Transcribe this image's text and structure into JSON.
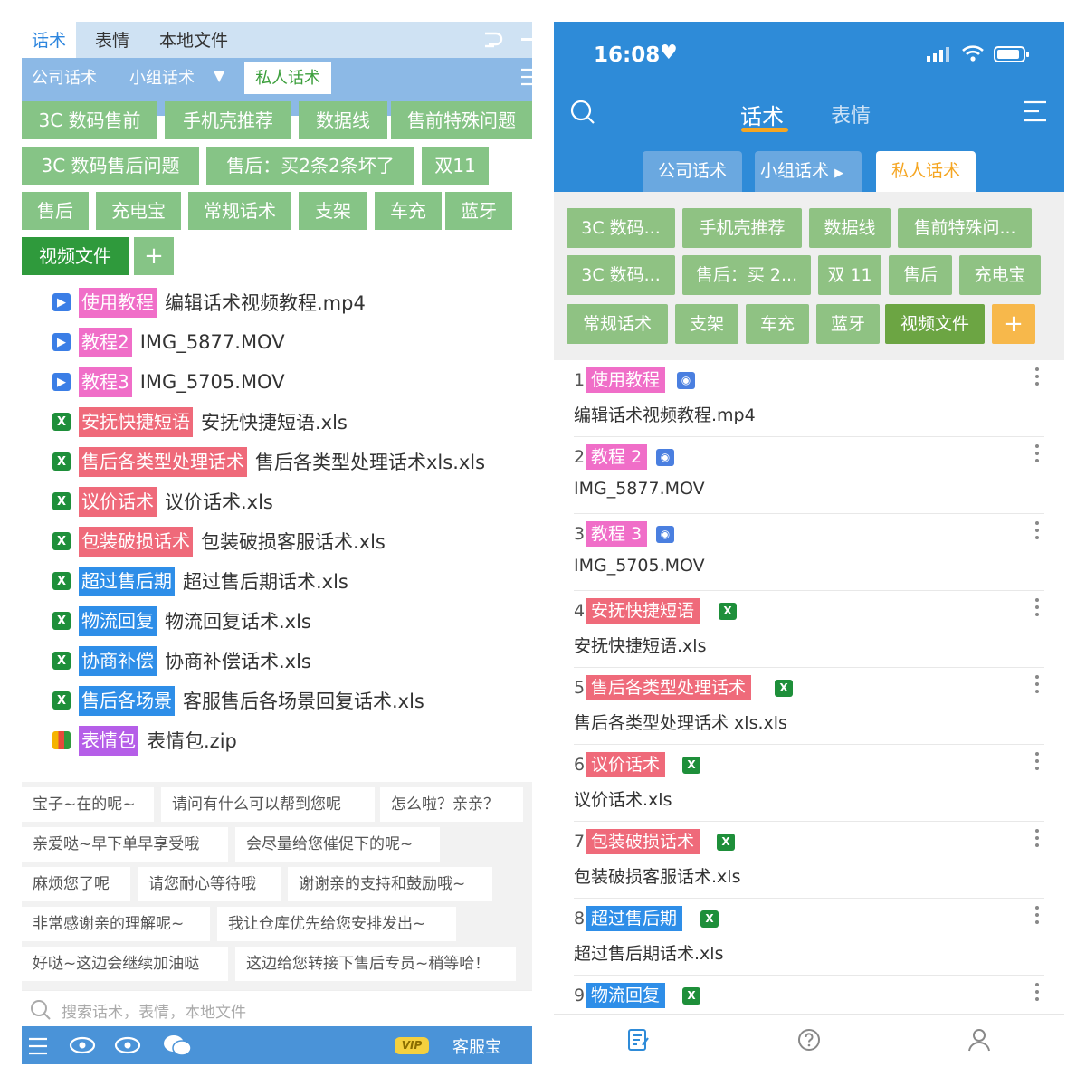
{
  "colors": {
    "pink": "#f06ec8",
    "red": "#ef6a7a",
    "blue": "#2e8ee8",
    "purple": "#b55ee8",
    "green": "#86c486",
    "dark_green": "#2f9a3c",
    "app_blue": "#2e8bd8",
    "orange": "#f5a623"
  },
  "left": {
    "top_tabs": [
      "话术",
      "表情",
      "本地文件"
    ],
    "sub_tabs": {
      "company": "公司话术",
      "group": "小组话术",
      "private": "私人话术"
    },
    "categories": [
      "3C 数码售前",
      "手机壳推荐",
      "数据线",
      "售前特殊问题",
      "3C 数码售后问题",
      "售后：买2条2条坏了",
      "双11",
      "售后",
      "充电宝",
      "常规话术",
      "支架",
      "车充",
      "蓝牙",
      "视频文件"
    ],
    "add_label": "+",
    "files": [
      {
        "icon": "video-icon",
        "tag": "使用教程",
        "color": "pink",
        "name": "编辑话术视频教程.mp4"
      },
      {
        "icon": "video-icon",
        "tag": "教程2",
        "color": "pink",
        "name": "IMG_5877.MOV"
      },
      {
        "icon": "video-icon",
        "tag": "教程3",
        "color": "pink",
        "name": "IMG_5705.MOV"
      },
      {
        "icon": "excel-icon",
        "tag": "安抚快捷短语",
        "color": "red",
        "name": "安抚快捷短语.xls"
      },
      {
        "icon": "excel-icon",
        "tag": "售后各类型处理话术",
        "color": "red",
        "name": "售后各类型处理话术xls.xls"
      },
      {
        "icon": "excel-icon",
        "tag": "议价话术",
        "color": "red",
        "name": "议价话术.xls"
      },
      {
        "icon": "excel-icon",
        "tag": "包装破损话术",
        "color": "red",
        "name": "包装破损客服话术.xls"
      },
      {
        "icon": "excel-icon",
        "tag": "超过售后期",
        "color": "blue",
        "name": "超过售后期话术.xls"
      },
      {
        "icon": "excel-icon",
        "tag": "物流回复",
        "color": "blue",
        "name": "物流回复话术.xls"
      },
      {
        "icon": "excel-icon",
        "tag": "协商补偿",
        "color": "blue",
        "name": "协商补偿话术.xls"
      },
      {
        "icon": "excel-icon",
        "tag": "售后各场景",
        "color": "blue",
        "name": "客服售后各场景回复话术.xls"
      },
      {
        "icon": "zip-icon",
        "tag": "表情包",
        "color": "purple",
        "name": "表情包.zip"
      }
    ],
    "phrases": [
      "宝子~在的呢~",
      "请问有什么可以帮到您呢",
      "怎么啦？亲亲？",
      "亲爱哒~早下单早享受哦",
      "会尽量给您催促下的呢~",
      "麻烦您了呢",
      "请您耐心等待哦",
      "谢谢亲的支持和鼓励哦~",
      "非常感谢亲的理解呢~",
      "我让仓库优先给您安排发出~",
      "好哒~这边会继续加油哒",
      "这边给您转接下售后专员~稍等哈！"
    ],
    "search_placeholder": "搜索话术，表情，本地文件",
    "vip_label": "VIP",
    "kefu_label": "客服宝"
  },
  "right": {
    "status": {
      "time": "16:08"
    },
    "tabs": {
      "huashu": "话术",
      "biaoqing": "表情"
    },
    "sub_tabs": {
      "company": "公司话术",
      "group": "小组话术",
      "private": "私人话术"
    },
    "categories": [
      "3C 数码...",
      "手机壳推荐",
      "数据线",
      "售前特殊问...",
      "3C 数码...",
      "售后：买 2...",
      "双 11",
      "售后",
      "充电宝",
      "常规话术",
      "支架",
      "车充",
      "蓝牙",
      "视频文件"
    ],
    "add_label": "+",
    "items": [
      {
        "num": "1",
        "tag": "使用教程",
        "color": "pink",
        "type": "video",
        "name": "编辑话术视频教程.mp4"
      },
      {
        "num": "2",
        "tag": "教程 2",
        "color": "pink",
        "type": "video",
        "name": "IMG_5877.MOV"
      },
      {
        "num": "3",
        "tag": "教程 3",
        "color": "pink",
        "type": "video",
        "name": "IMG_5705.MOV"
      },
      {
        "num": "4",
        "tag": "安抚快捷短语",
        "color": "red",
        "type": "xls",
        "name": "安抚快捷短语.xls"
      },
      {
        "num": "5",
        "tag": "售后各类型处理话术",
        "color": "red",
        "type": "xls",
        "name": "售后各类型处理话术 xls.xls"
      },
      {
        "num": "6",
        "tag": "议价话术",
        "color": "red",
        "type": "xls",
        "name": "议价话术.xls"
      },
      {
        "num": "7",
        "tag": "包装破损话术",
        "color": "red",
        "type": "xls",
        "name": "包装破损客服话术.xls"
      },
      {
        "num": "8",
        "tag": "超过售后期",
        "color": "blue",
        "type": "xls",
        "name": "超过售后期话术.xls"
      },
      {
        "num": "9",
        "tag": "物流回复",
        "color": "blue",
        "type": "xls",
        "name": ""
      }
    ],
    "bottom_tabs": [
      "edit-icon",
      "help-icon",
      "user-icon"
    ]
  }
}
